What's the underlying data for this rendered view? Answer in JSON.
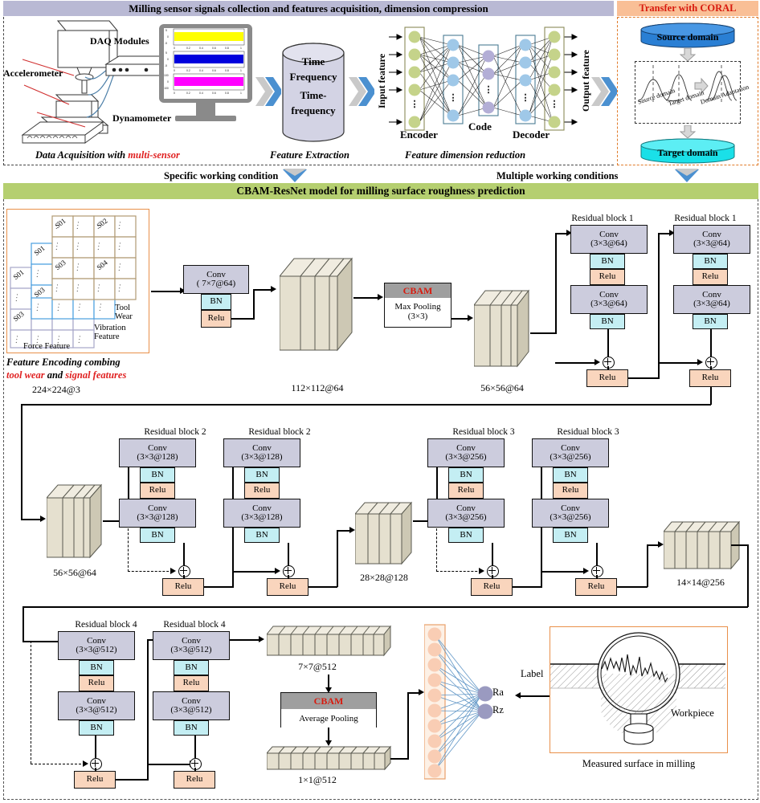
{
  "banners": {
    "top": "Milling sensor signals collection and features acquisition, dimension compression",
    "coral": "Transfer with CORAL",
    "model": "CBAM-ResNet model for milling surface roughness prediction"
  },
  "acquisition": {
    "accelerometer": "Accelerometer",
    "dynamometer": "Dynamometer",
    "daq": "DAQ Modules",
    "caption_plain": "Data Acquisition with ",
    "caption_red": "multi-sensor",
    "monitor_axis_ticks": [
      "0",
      "0.2",
      "0.4",
      "0.6",
      "0.8",
      "1"
    ],
    "signal_colors": [
      "#ffff00",
      "#0000dd",
      "#ff00ff"
    ],
    "y_ticks_a": [
      "5",
      "0",
      "-5"
    ],
    "y_ticks_b": [
      "5",
      "0",
      "-5"
    ],
    "y_ticks_c": [
      "100",
      "0",
      "-100"
    ]
  },
  "extraction": {
    "line1": "Time",
    "line2": "Frequency",
    "line3": "Time-",
    "line4": "frequency",
    "caption": "Feature Extraction"
  },
  "autoencoder": {
    "input_label": "Input feature",
    "output_label": "Output feature",
    "encoder": "Encoder",
    "code": "Code",
    "decoder": "Decoder",
    "caption": "Feature dimension reduction",
    "dots": "⋮"
  },
  "coral": {
    "source": "Source domain",
    "target": "Target domain",
    "curve_labels": [
      "Source domain",
      "Target domain",
      "Domain Adaptation"
    ]
  },
  "flow_labels": {
    "specific": "Specific working condition",
    "multiple": "Multiple working conditions"
  },
  "encoding": {
    "cells": [
      "S01",
      "S02",
      "S03",
      "S04"
    ],
    "tool_wear": "Tool Wear",
    "vibration": "Vibration Feature",
    "force": "Force Feature",
    "caption_line1": "Feature Encoding combing",
    "caption_line2_a": "tool wear",
    "caption_line2_b": " and ",
    "caption_line2_c": "signal features",
    "dim": "224×224@3",
    "colors": {
      "tool": "#b09a73",
      "vibration": "#4a9fe0",
      "force": "#a6a6c8",
      "frame": "#e9904a"
    }
  },
  "stem": {
    "conv_title": "Conv",
    "conv_spec": "( 7×7@64)",
    "bn": "BN",
    "relu": "Relu"
  },
  "cbam1": {
    "title": "CBAM",
    "body1": "Max Pooling",
    "body2": "(3×3)"
  },
  "cbam2": {
    "title": "CBAM",
    "body": "Average Pooling"
  },
  "dims": {
    "d112": "112×112@64",
    "d56a": "56×56@64",
    "d56b": "56×56@64",
    "d28": "28×28@128",
    "d14": "14×14@256",
    "d7": "7×7@512",
    "d1": "1×1@512"
  },
  "blocks": {
    "labels": {
      "rb1": "Residual block 1",
      "rb2": "Residual block 2",
      "rb3": "Residual block 3",
      "rb4": "Residual block 4"
    },
    "conv_title": "Conv",
    "specs": {
      "c64": "(3×3@64)",
      "c128": "(3×3@128)",
      "c256": "(3×3@256)",
      "c512": "(3×3@512)"
    },
    "bn": "BN",
    "relu": "Relu"
  },
  "output": {
    "ra": "Ra",
    "rz": "Rz",
    "label": "Label",
    "workpiece": "Workpiece",
    "caption": "Measured surface in milling",
    "node_color": "#f9cdb4",
    "out_color": "#9a9ac0"
  },
  "colors": {
    "conv": "#ccccdd",
    "bn": "#c4eef3",
    "relu": "#f9d5bd",
    "cbam_header": "#9f9f9f",
    "cbam_red": "#d81b0f",
    "slab": "#e5e0cf",
    "slab_top": "#f0ece0",
    "slab_side": "#cdc8b4",
    "banner_top": "#b9b9d4",
    "banner_coral": "#f9bf96",
    "banner_green": "#b5cf70",
    "source_domain": "#2a7fd4",
    "target_domain": "#1ae0e8",
    "chevron_blue": "#4b90d0",
    "chevron_gray": "#c9c9c9"
  }
}
